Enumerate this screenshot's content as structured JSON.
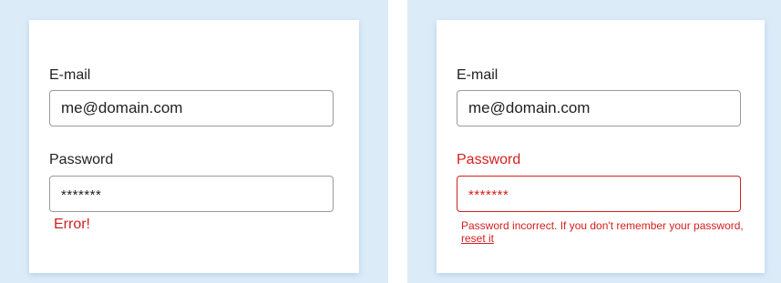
{
  "left_form": {
    "email_label": "E-mail",
    "email_value": "me@domain.com",
    "password_label": "Password",
    "password_value": "*******",
    "error_message": "Error!"
  },
  "right_form": {
    "email_label": "E-mail",
    "email_value": "me@domain.com",
    "password_label": "Password",
    "password_value": "*******",
    "error_message": "Password incorrect. If you don't remember your password,",
    "reset_link": "reset it"
  },
  "colors": {
    "background_panel": "#dcebf8",
    "card": "#ffffff",
    "error": "#d32020",
    "border": "#9a9a9a",
    "text": "#222222"
  }
}
